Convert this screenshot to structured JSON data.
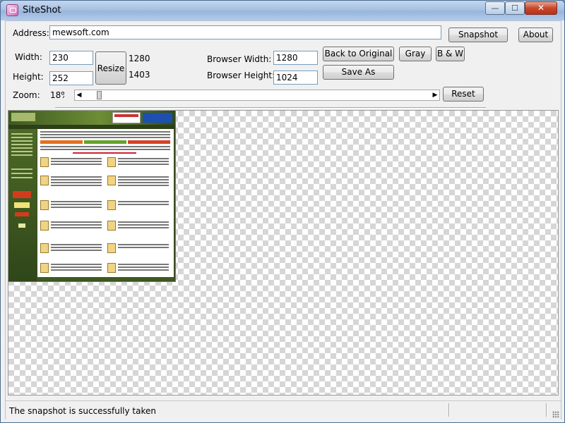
{
  "window": {
    "title": "SiteShot",
    "min_glyph": "—",
    "max_glyph": "☐",
    "close_glyph": "✕"
  },
  "address": {
    "label": "Address:",
    "value": "mewsoft.com"
  },
  "buttons": {
    "snapshot": "Snapshot",
    "about": "About",
    "resize": "Resize",
    "back_to_original": "Back to Original",
    "gray": "Gray",
    "bw": "B & W",
    "save_as": "Save As",
    "reset": "Reset"
  },
  "size": {
    "width_label": "Width:",
    "width_value": "230",
    "height_label": "Height:",
    "height_value": "252",
    "original_width": "1280",
    "original_height": "1403"
  },
  "browser": {
    "width_label": "Browser Width:",
    "width_value": "1280",
    "height_label": "Browser Height:",
    "height_value": "1024"
  },
  "zoom": {
    "label": "Zoom:",
    "value_text": "18%",
    "level_percent": 18,
    "left_arrow": "◀",
    "right_arrow": "▶"
  },
  "status": {
    "message": "The snapshot is successfully taken"
  }
}
